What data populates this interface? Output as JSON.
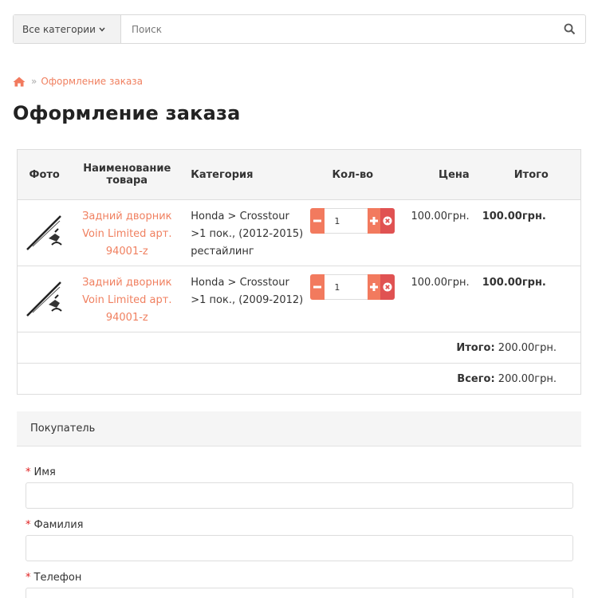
{
  "search": {
    "category_label": "Все категории",
    "placeholder": "Поиск"
  },
  "breadcrumb": {
    "separator": "»",
    "current": "Оформление заказа"
  },
  "page_title": "Оформление заказа",
  "cart": {
    "headers": {
      "photo": "Фото",
      "name": "Наименование товара",
      "category": "Категория",
      "qty": "Кол-во",
      "price": "Цена",
      "total": "Итого"
    },
    "items": [
      {
        "name": "Задний дворник Voin Limited арт. 94001-z",
        "category": "Honda > Crosstour >1 пок., (2012-2015) рестайлинг",
        "qty": "1",
        "price": "100.00грн.",
        "total": "100.00грн."
      },
      {
        "name": "Задний дворник Voin Limited арт. 94001-z",
        "category": "Honda > Crosstour >1 пок., (2009-2012)",
        "qty": "1",
        "price": "100.00грн.",
        "total": "100.00грн."
      }
    ],
    "subtotal": {
      "label": "Итого:",
      "value": "200.00грн."
    },
    "grand_total": {
      "label": "Всего:",
      "value": "200.00грн."
    }
  },
  "buyer": {
    "heading": "Покупатель",
    "required_mark": "*",
    "first_name_label": "Имя",
    "last_name_label": "Фамилия",
    "phone_label": "Телефон"
  },
  "colors": {
    "accent": "#f27a5e",
    "link": "#f08060",
    "remove": "#e05252",
    "required": "#e02020"
  }
}
